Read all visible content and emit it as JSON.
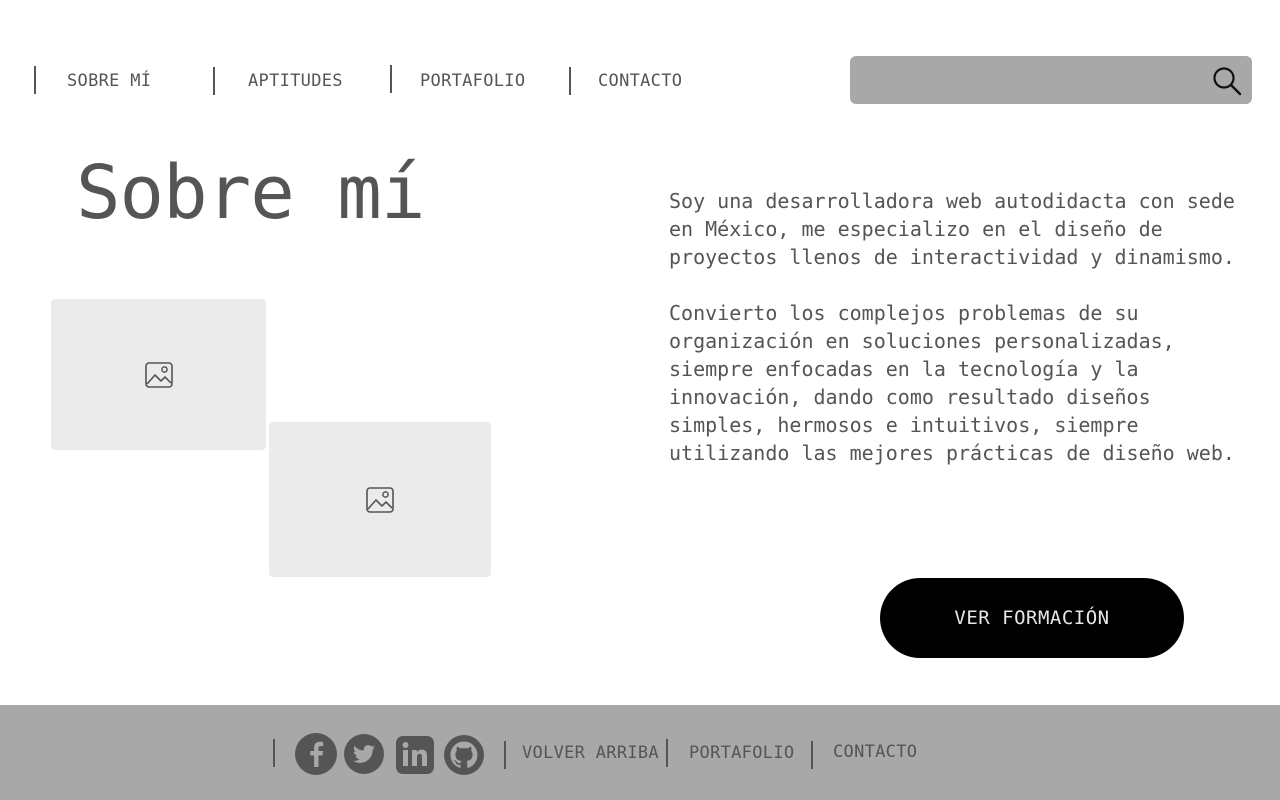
{
  "nav": {
    "items": [
      {
        "label": "SOBRE MÍ"
      },
      {
        "label": "APTITUDES"
      },
      {
        "label": "PORTAFOLIO"
      },
      {
        "label": "CONTACTO"
      }
    ]
  },
  "search": {
    "placeholder": "",
    "value": "",
    "icon": "search-icon"
  },
  "hero": {
    "title": "Sobre mí",
    "paragraphs": [
      "Soy una desarrolladora web autodidacta con sede en México, me especializo en el diseño de proyectos llenos de interactividad y dinamismo.",
      "Convierto los complejos problemas de su organización en soluciones personalizadas, siempre enfocadas en la tecnología y la innovación, dando como resultado diseños simples, hermosos e intuitivos, siempre utilizando las mejores prácticas de diseño web."
    ],
    "button_label": "VER FORMACIÓN",
    "images": [
      {
        "icon": "image-icon"
      },
      {
        "icon": "image-icon"
      }
    ]
  },
  "footer": {
    "social": [
      {
        "icon": "facebook-icon"
      },
      {
        "icon": "twitter-icon"
      },
      {
        "icon": "linkedin-icon"
      },
      {
        "icon": "github-icon"
      }
    ],
    "links": [
      {
        "label": "VOLVER ARRIBA"
      },
      {
        "label": "PORTAFOLIO"
      },
      {
        "label": "CONTACTO"
      }
    ]
  },
  "colors": {
    "text": "#555555",
    "search_bg": "#a8a8a8",
    "footer_bg": "#a8a8a8",
    "button_bg": "#000000",
    "button_text": "#e6e6e6",
    "image_placeholder": "#ebebeb"
  }
}
